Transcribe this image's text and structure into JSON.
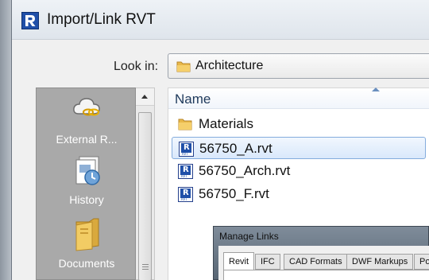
{
  "window": {
    "title": "Import/Link RVT"
  },
  "lookin": {
    "label": "Look in:",
    "value": "Architecture"
  },
  "places": [
    {
      "label": "External R...",
      "icon": "cloud-link-icon"
    },
    {
      "label": "History",
      "icon": "history-icon"
    },
    {
      "label": "Documents",
      "icon": "documents-folder-icon"
    }
  ],
  "filelist": {
    "column_name": "Name",
    "items": [
      {
        "name": "Materials",
        "type": "folder",
        "selected": false
      },
      {
        "name": "56750_A.rvt",
        "type": "rvt",
        "selected": true
      },
      {
        "name": "56750_Arch.rvt",
        "type": "rvt",
        "selected": false
      },
      {
        "name": "56750_F.rvt",
        "type": "rvt",
        "selected": false
      }
    ]
  },
  "manage_links": {
    "title": "Manage Links",
    "tabs": [
      "Revit",
      "IFC",
      "CAD Formats",
      "DWF Markups",
      "Poin"
    ],
    "active_tab": "Revit"
  },
  "colors": {
    "selection_border": "#84acdd",
    "places_bg": "#a9a9a9",
    "revit_blue": "#1f4fa8"
  }
}
